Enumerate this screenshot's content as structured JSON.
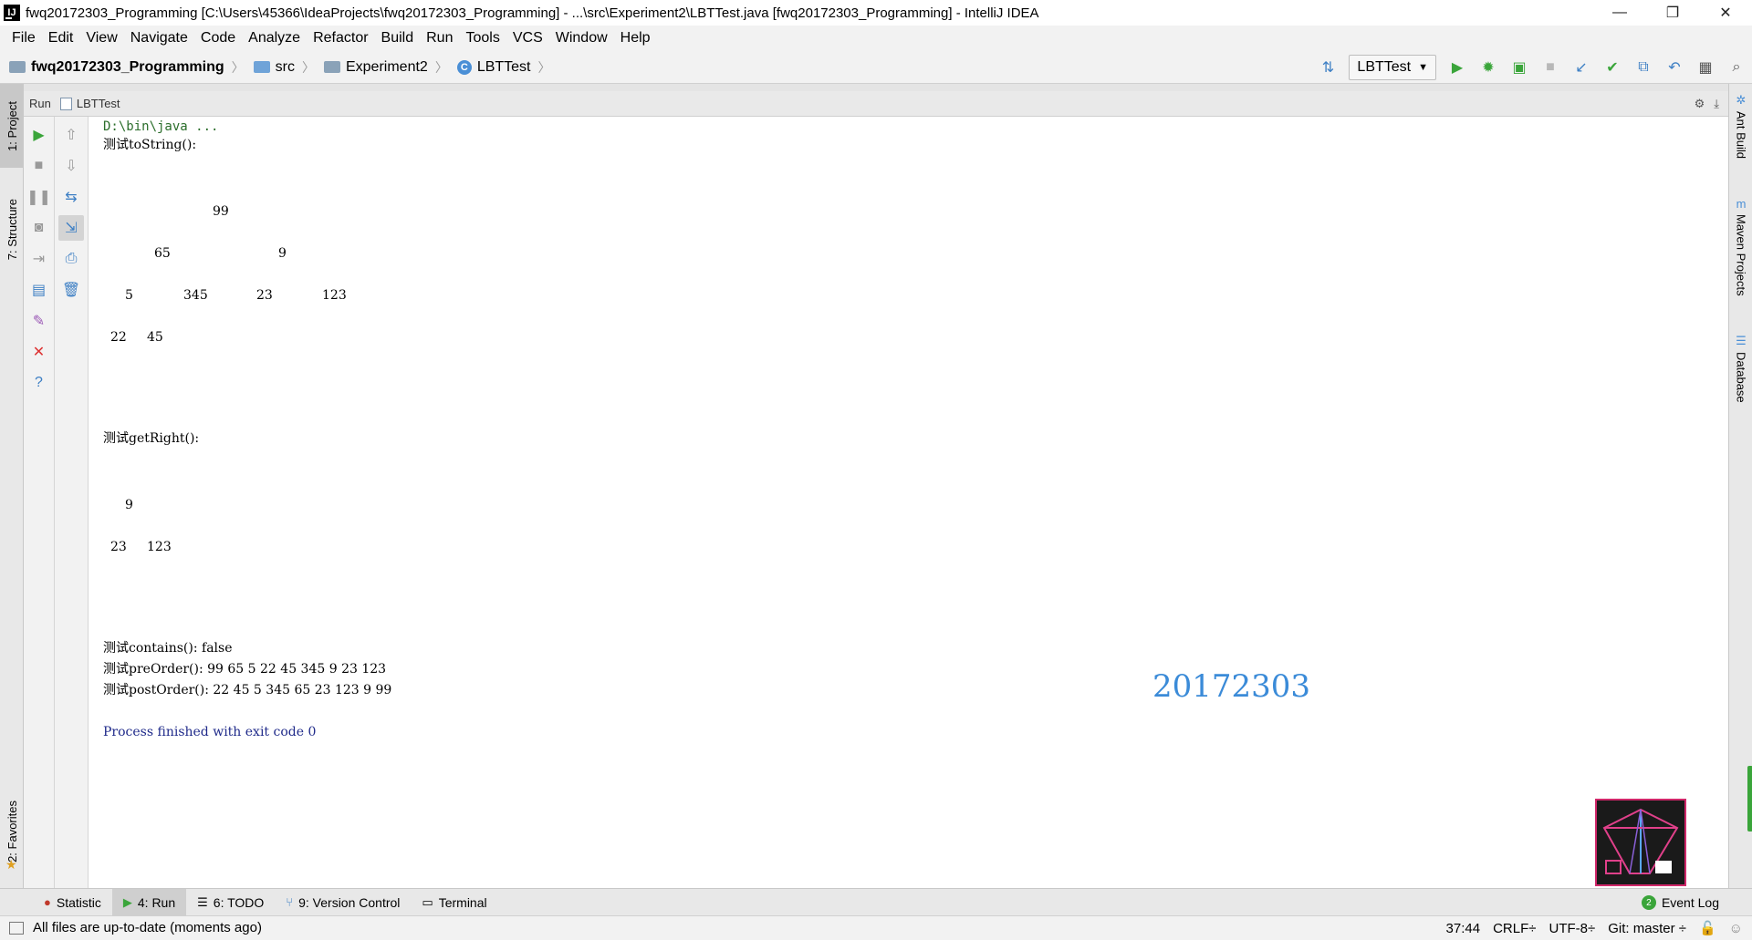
{
  "window": {
    "title": "fwq20172303_Programming [C:\\Users\\45366\\IdeaProjects\\fwq20172303_Programming] - ...\\src\\Experiment2\\LBTTest.java [fwq20172303_Programming] - IntelliJ IDEA",
    "app_icon": "IJ",
    "controls": {
      "minimize": "—",
      "restore": "❐",
      "close": "✕"
    }
  },
  "menu": [
    "File",
    "Edit",
    "View",
    "Navigate",
    "Code",
    "Analyze",
    "Refactor",
    "Build",
    "Run",
    "Tools",
    "VCS",
    "Window",
    "Help"
  ],
  "breadcrumb": {
    "project": "fwq20172303_Programming",
    "src": "src",
    "package": "Experiment2",
    "class": "LBTTest",
    "class_icon": "C"
  },
  "toolbar": {
    "run_config": "LBTTest",
    "icons": [
      "build-icon",
      "run-icon",
      "debug-icon",
      "coverage-icon",
      "stop-icon",
      "vcs-update-icon",
      "vcs-commit-icon",
      "compare-icon",
      "revert-icon",
      "project-structure-icon",
      "search-icon"
    ]
  },
  "left_tabs": {
    "project": "1: Project",
    "structure": "7: Structure",
    "favorites": "2: Favorites"
  },
  "right_tabs": {
    "ant": "Ant Build",
    "maven": "Maven Projects",
    "maven_icon": "m",
    "database": "Database"
  },
  "run_panel": {
    "label": "Run",
    "config": "LBTTest"
  },
  "console": {
    "command": "D:\\bin\\java ...",
    "tostring_label": "测试toString():",
    "tree": {
      "row1": [
        "99"
      ],
      "row2": [
        "65",
        "9"
      ],
      "row3": [
        "5",
        "345",
        "23",
        "123"
      ],
      "row4": [
        "22",
        "45"
      ]
    },
    "getright_label": "测试getRight():",
    "right_tree": {
      "row1": [
        "9"
      ],
      "row2": [
        "23",
        "123"
      ]
    },
    "contains": "测试contains(): false",
    "preorder": "测试preOrder(): 99 65 5 22 45 345 9 23 123",
    "postorder": "测试postOrder(): 22 45 5 345 65 23 123 9 99",
    "exit": "Process finished with exit code 0",
    "watermark": "20172303"
  },
  "bottom_tools": {
    "statistic": "Statistic",
    "run": "4: Run",
    "todo": "6: TODO",
    "vcs": "9: Version Control",
    "terminal": "Terminal",
    "event_log": "Event Log",
    "event_count": "2"
  },
  "status": {
    "message": "All files are up-to-date (moments ago)",
    "position": "37:44",
    "line_sep": "CRLF÷",
    "encoding": "UTF-8÷",
    "vcs": "Git: master ÷"
  },
  "colors": {
    "exit_text": "#1f2a8a",
    "watermark": "#3b8bd8",
    "run_green": "#3aa53a"
  }
}
